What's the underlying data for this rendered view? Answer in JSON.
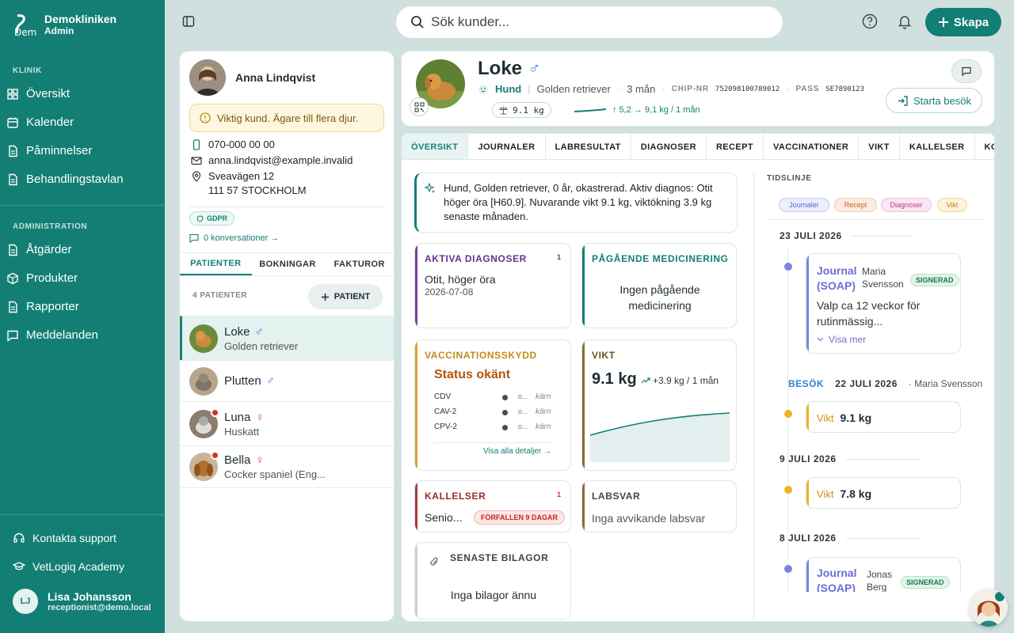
{
  "app": {
    "name": "Demokliniken",
    "role": "Admin"
  },
  "sidebar": {
    "section_klinik": "KLINIK",
    "klinik_items": [
      {
        "label": "Översikt",
        "icon": "grid-icon"
      },
      {
        "label": "Kalender",
        "icon": "calendar-icon"
      },
      {
        "label": "Påminnelser",
        "icon": "document-icon"
      },
      {
        "label": "Behandlingstavlan",
        "icon": "document-icon"
      }
    ],
    "section_admin": "ADMINISTRATION",
    "admin_items": [
      {
        "label": "Åtgärder",
        "icon": "document-icon"
      },
      {
        "label": "Produkter",
        "icon": "box-icon"
      },
      {
        "label": "Rapporter",
        "icon": "document-icon"
      },
      {
        "label": "Meddelanden",
        "icon": "message-icon"
      }
    ],
    "support": "Kontakta support",
    "academy": "VetLogiq Academy",
    "user": {
      "initials": "LJ",
      "name": "Lisa Johansson",
      "email": "receptionist@demo.local"
    }
  },
  "topbar": {
    "search_placeholder": "Sök kunder...",
    "create_label": "Skapa"
  },
  "owner": {
    "name": "Anna Lindqvist",
    "warning": "Viktig kund. Ägare till flera djur.",
    "phone": "070-000 00 00",
    "email": "anna.lindqvist@example.invalid",
    "street": "Sveavägen 12",
    "city": "111 57 STOCKHOLM",
    "gdpr": "GDPR",
    "conversations": "0 konversationer →",
    "tabs": [
      "PATIENTER",
      "BOKNINGAR",
      "FAKTUROR"
    ],
    "patient_count": "4 PATIENTER",
    "add_patient": "PATIENT",
    "patients": [
      {
        "name": "Loke",
        "sex": "♂",
        "breed": "Golden retriever",
        "alert": false
      },
      {
        "name": "Plutten",
        "sex": "♂",
        "breed": "",
        "alert": false
      },
      {
        "name": "Luna",
        "sex": "♀",
        "breed": "Huskatt",
        "alert": true
      },
      {
        "name": "Bella",
        "sex": "♀",
        "breed": "Cocker spaniel (Eng...",
        "alert": true
      }
    ]
  },
  "patient": {
    "name": "Loke",
    "sex": "♂",
    "species": "Hund",
    "breed": "Golden retriever",
    "age": "3 mån",
    "chip_label": "CHIP-NR",
    "chip": "752098100789012",
    "pass_label": "PASS",
    "pass": "SE7890123",
    "weight": "9.1 kg",
    "trend": "↑ 5,2 → 9,1 kg / 1 mån",
    "start_visit": "Starta besök"
  },
  "tabs": [
    "ÖVERSIKT",
    "JOURNALER",
    "LABRESULTAT",
    "DIAGNOSER",
    "RECEPT",
    "VACCINATIONER",
    "VIKT",
    "KALLELSER",
    "KOSTNADS"
  ],
  "summary": "Hund, Golden retriever, 0 år, okastrerad. Aktiv diagnos: Otit höger öra [H60.9]. Nuvarande vikt 9.1 kg, viktökning 3.9 kg senaste månaden.",
  "cards": {
    "diag": {
      "title": "AKTIVA DIAGNOSER",
      "count": "1",
      "name": "Otit, höger öra",
      "date": "2026-07-08"
    },
    "med": {
      "title": "PÅGÅENDE MEDICINERING",
      "empty": "Ingen pågående medicinering"
    },
    "vacc": {
      "title": "VACCINATIONSSKYDD",
      "status": "Status okänt",
      "rows": [
        {
          "name": "CDV",
          "o": "o...",
          "k": "kärn"
        },
        {
          "name": "CAV-2",
          "o": "o...",
          "k": "kärn"
        },
        {
          "name": "CPV-2",
          "o": "o...",
          "k": "kärn"
        }
      ],
      "link": "Visa alla detaljer →"
    },
    "weight": {
      "title": "VIKT",
      "value": "9.1 kg",
      "delta": "+3.9 kg / 1 mån"
    },
    "recall": {
      "title": "KALLELSER",
      "count": "1",
      "item": "Senio...",
      "badge": "FÖRFALLEN 9 DAGAR"
    },
    "lab": {
      "title": "LABSVAR",
      "text": "Inga avvikande labsvar"
    },
    "attach": {
      "title": "SENASTE BILAGOR",
      "text": "Inga bilagor ännu"
    }
  },
  "timeline": {
    "title": "TIDSLINJE",
    "chips": [
      "Journaler",
      "Recept",
      "Diagnoser",
      "Vikt"
    ],
    "d1": "23 JULI 2026",
    "j1": {
      "type": "Journal (SOAP)",
      "author": "Maria Svensson",
      "badge": "SIGNERAD",
      "text": "Valp ca 12 veckor för rutinmässig...",
      "more": "Visa mer"
    },
    "visit": {
      "label": "BESÖK",
      "date": "22 JULI 2026",
      "author": "· Maria Svensson"
    },
    "w1": {
      "label": "Vikt",
      "value": "9.1 kg"
    },
    "d2": "9 JULI 2026",
    "w2": {
      "label": "Vikt",
      "value": "7.8 kg"
    },
    "d3": "8 JULI 2026",
    "j2": {
      "type": "Journal (SOAP)",
      "author": "Jonas Berg",
      "badge": "SIGNERAD"
    }
  },
  "colors": {
    "brand": "#137f74",
    "diag": "#7b3fa0",
    "vacc": "#e0a030",
    "weight": "#8a6a3a",
    "recall": "#a83c3c",
    "journal": "#6b6fd6"
  }
}
